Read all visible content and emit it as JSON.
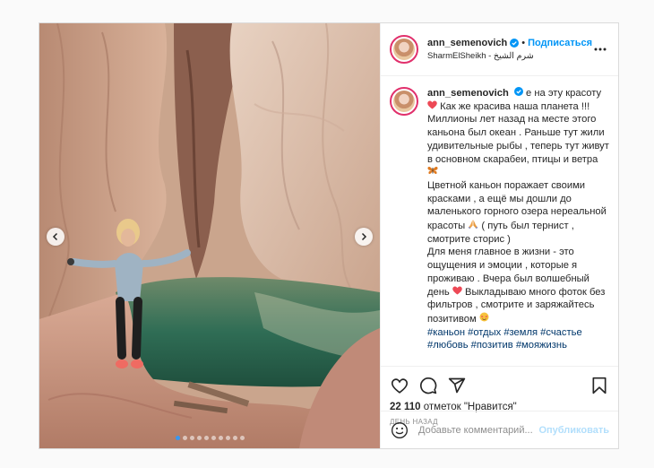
{
  "post": {
    "username": "ann_semenovich",
    "follow_label": "Подписаться",
    "separator": "•",
    "location": "SharmElSheikh - شرم الشيخ",
    "caption_parts": [
      " е на эту красоту ",
      " Как же красива наша планета !!! Миллионы лет назад на месте этого каньона был океан . Раньше тут жили удивительные рыбы , теперь тут живут в основном скарабеи, птицы и ветра ",
      "Цветной каньон поражает своими красками , а ещё мы дошли до маленького горного озера нереальной красоты ",
      "( путь был тернист , смотрите сторис )",
      "Для меня главное в жизни - это ощущения и эмоции , которые я проживаю . Вчера был волшебный день ",
      " Выкладываю много фоток без фильтров , смотрите и заряжайтесь позитивом "
    ],
    "hashtags": "#каньон #отдых #земля #счастье #любовь #позитив #мояжизнь",
    "likes_count": "22 110",
    "likes_word": "отметок \"Нравится\"",
    "date": "День назад",
    "comment_placeholder": "Добавьте комментарий...",
    "publish_label": "Опубликовать",
    "carousel": {
      "total": 10,
      "active_index": 0
    },
    "icons": [
      "verified-icon",
      "more-icon",
      "heart-icon",
      "butterfly-icon",
      "praying-hands-icon",
      "smiling-hearts-icon",
      "like-icon",
      "comment-icon",
      "share-icon",
      "save-icon",
      "emoji-icon",
      "chevron-left-icon",
      "chevron-right-icon"
    ],
    "colors": {
      "accent": "#0095f6",
      "border": "#dbdbdb",
      "link": "#00376b",
      "heart": "#ed4956",
      "publish_disabled": "#b2dffc"
    }
  }
}
